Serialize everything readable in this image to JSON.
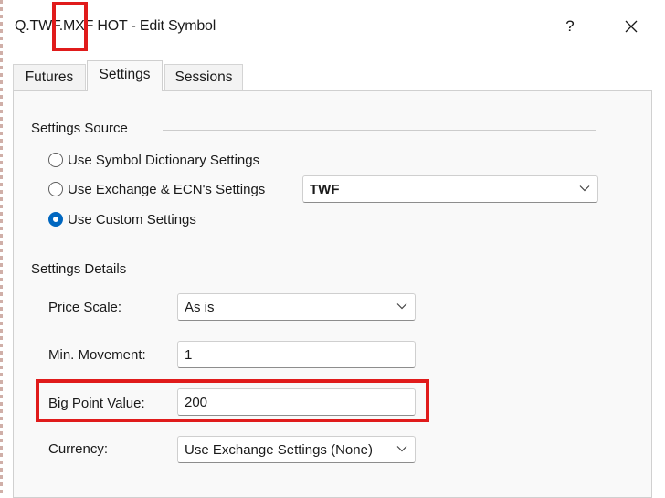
{
  "window": {
    "title": "Q.TWF.MXF HOT - Edit Symbol",
    "help_label": "?"
  },
  "tabs": [
    {
      "label": "Futures",
      "active": false
    },
    {
      "label": "Settings",
      "active": true
    },
    {
      "label": "Sessions",
      "active": false
    }
  ],
  "settings_source": {
    "group_label": "Settings Source",
    "options": [
      {
        "label": "Use Symbol Dictionary Settings",
        "checked": false
      },
      {
        "label": "Use Exchange & ECN's Settings",
        "checked": false
      },
      {
        "label": "Use Custom Settings",
        "checked": true
      }
    ],
    "exchange_select": {
      "value": "TWF"
    }
  },
  "settings_details": {
    "group_label": "Settings Details",
    "price_scale": {
      "label": "Price Scale:",
      "value": "As is"
    },
    "min_movement": {
      "label": "Min. Movement:",
      "value": "1"
    },
    "big_point_value": {
      "label": "Big Point Value:",
      "value": "200"
    },
    "currency": {
      "label": "Currency:",
      "value": "Use Exchange Settings (None)"
    }
  },
  "colors": {
    "accent": "#0067c0",
    "highlight": "#e01b1b"
  }
}
